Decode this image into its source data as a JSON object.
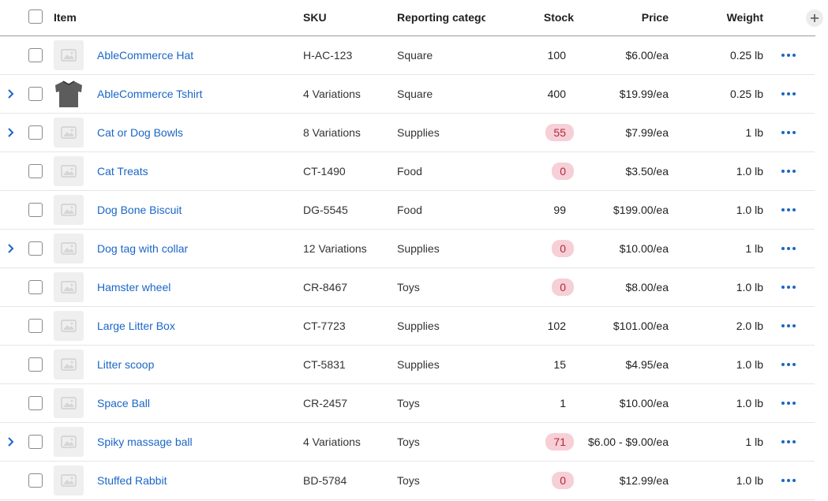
{
  "header": {
    "item": "Item",
    "sku": "SKU",
    "category": "Reporting catego",
    "stock": "Stock",
    "price": "Price",
    "weight": "Weight"
  },
  "rows": [
    {
      "name": "AbleCommerce Hat",
      "sku": "H-AC-123",
      "category": "Square",
      "stock": "100",
      "price": "$6.00/ea",
      "weight": "0.25 lb",
      "expandable": false,
      "low": false,
      "image": "placeholder"
    },
    {
      "name": "AbleCommerce Tshirt",
      "sku": "4 Variations",
      "category": "Square",
      "stock": "400",
      "price": "$19.99/ea",
      "weight": "0.25 lb",
      "expandable": true,
      "low": false,
      "image": "tshirt"
    },
    {
      "name": "Cat or Dog Bowls",
      "sku": "8 Variations",
      "category": "Supplies",
      "stock": "55",
      "price": "$7.99/ea",
      "weight": "1 lb",
      "expandable": true,
      "low": true,
      "image": "placeholder"
    },
    {
      "name": "Cat Treats",
      "sku": "CT-1490",
      "category": "Food",
      "stock": "0",
      "price": "$3.50/ea",
      "weight": "1.0 lb",
      "expandable": false,
      "low": true,
      "image": "placeholder"
    },
    {
      "name": "Dog Bone Biscuit",
      "sku": "DG-5545",
      "category": "Food",
      "stock": "99",
      "price": "$199.00/ea",
      "weight": "1.0 lb",
      "expandable": false,
      "low": false,
      "image": "placeholder"
    },
    {
      "name": "Dog tag with collar",
      "sku": "12 Variations",
      "category": "Supplies",
      "stock": "0",
      "price": "$10.00/ea",
      "weight": "1 lb",
      "expandable": true,
      "low": true,
      "image": "placeholder"
    },
    {
      "name": "Hamster wheel",
      "sku": "CR-8467",
      "category": "Toys",
      "stock": "0",
      "price": "$8.00/ea",
      "weight": "1.0 lb",
      "expandable": false,
      "low": true,
      "image": "placeholder"
    },
    {
      "name": "Large Litter Box",
      "sku": "CT-7723",
      "category": "Supplies",
      "stock": "102",
      "price": "$101.00/ea",
      "weight": "2.0 lb",
      "expandable": false,
      "low": false,
      "image": "placeholder"
    },
    {
      "name": "Litter scoop",
      "sku": "CT-5831",
      "category": "Supplies",
      "stock": "15",
      "price": "$4.95/ea",
      "weight": "1.0 lb",
      "expandable": false,
      "low": false,
      "image": "placeholder"
    },
    {
      "name": "Space Ball",
      "sku": "CR-2457",
      "category": "Toys",
      "stock": "1",
      "price": "$10.00/ea",
      "weight": "1.0 lb",
      "expandable": false,
      "low": false,
      "image": "placeholder"
    },
    {
      "name": "Spiky massage ball",
      "sku": "4 Variations",
      "category": "Toys",
      "stock": "71",
      "price": "$6.00 - $9.00/ea",
      "weight": "1 lb",
      "expandable": true,
      "low": true,
      "image": "placeholder"
    },
    {
      "name": "Stuffed Rabbit",
      "sku": "BD-5784",
      "category": "Toys",
      "stock": "0",
      "price": "$12.99/ea",
      "weight": "1.0 lb",
      "expandable": false,
      "low": true,
      "image": "placeholder"
    }
  ],
  "icons": {
    "expand": "chevron-right-icon",
    "more": "more-actions-icon",
    "add_column": "plus-icon",
    "placeholder": "image-placeholder-icon"
  },
  "colors": {
    "link": "#1a66c7",
    "low_stock_bg": "#f7cfd7",
    "low_stock_text": "#b0293f"
  }
}
